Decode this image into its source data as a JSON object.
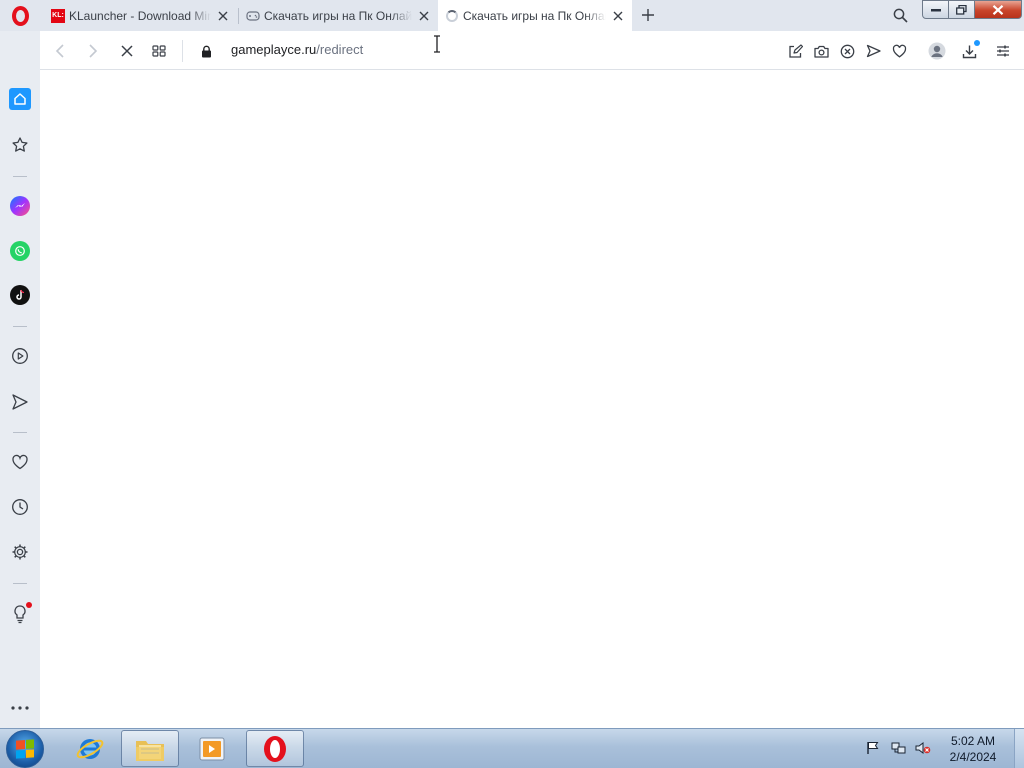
{
  "browser": {
    "tabs": [
      {
        "title": "KLauncher - Download Minecraft",
        "favicon": "klauncher-icon",
        "favicon_text": "KL:",
        "active": false
      },
      {
        "title": "Скачать игры на Пк Онлайн",
        "favicon": "gamepad-icon",
        "active": false
      },
      {
        "title": "Скачать игры на Пк Онлайн",
        "favicon": "loading-spinner-icon",
        "active": true
      }
    ],
    "address_bar": {
      "domain": "gameplayce.ru",
      "path": "/redirect",
      "loading": true
    },
    "sidebar": {
      "items": [
        "home",
        "bookmarks",
        "messenger",
        "whatsapp",
        "tiktok",
        "player",
        "send",
        "favorites",
        "history",
        "settings",
        "tips",
        "more"
      ]
    }
  },
  "taskbar": {
    "apps": [
      "internet-explorer",
      "windows-explorer",
      "media-player",
      "opera"
    ],
    "clock": {
      "time": "5:02 AM",
      "date": "2/4/2024"
    }
  },
  "colors": {
    "opera_red": "#e4101c",
    "accent_blue": "#1e98ff",
    "tabstrip_bg": "#e1e6ee",
    "sidebar_bg": "#e8ecf2"
  }
}
